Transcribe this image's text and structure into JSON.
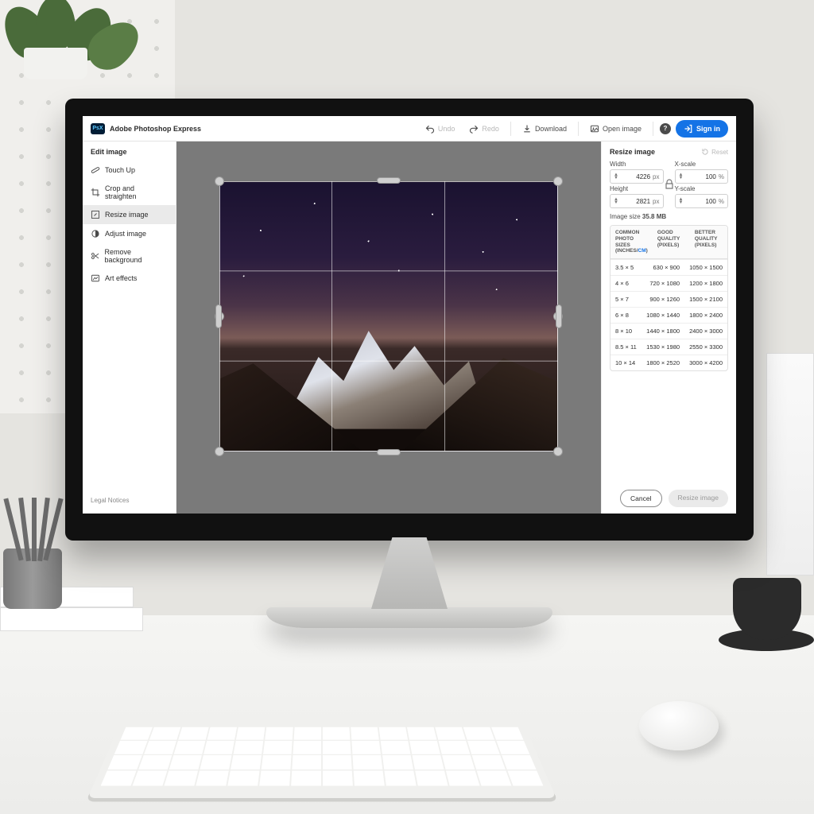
{
  "app": {
    "logo_text": "PsX",
    "title": "Adobe Photoshop Express"
  },
  "topbar": {
    "undo": "Undo",
    "redo": "Redo",
    "download": "Download",
    "open": "Open image",
    "signin": "Sign in",
    "help": "?"
  },
  "sidebar": {
    "title": "Edit image",
    "items": [
      {
        "label": "Touch Up"
      },
      {
        "label": "Crop and straighten"
      },
      {
        "label": "Resize image"
      },
      {
        "label": "Adjust image"
      },
      {
        "label": "Remove background"
      },
      {
        "label": "Art effects"
      }
    ],
    "active_index": 2,
    "legal": "Legal Notices"
  },
  "panel": {
    "title": "Resize image",
    "reset": "Reset",
    "width_label": "Width",
    "width_value": "4226",
    "width_unit": "px",
    "height_label": "Height",
    "height_value": "2821",
    "height_unit": "px",
    "xscale_label": "X-scale",
    "xscale_value": "100",
    "xscale_unit": "%",
    "yscale_label": "Y-scale",
    "yscale_value": "100",
    "yscale_unit": "%",
    "size_label": "Image size",
    "size_value": "35.8 MB",
    "table": {
      "head_sizes_l1": "COMMON",
      "head_sizes_l2": "PHOTO SIZES",
      "head_sizes_unit_in": "INCHES",
      "head_sizes_unit_sep": "/",
      "head_sizes_unit_cm": "CM",
      "head_good_l1": "GOOD",
      "head_good_l2": "QUALITY",
      "head_good_l3": "(PIXELS)",
      "head_better_l1": "BETTER",
      "head_better_l2": "QUALITY",
      "head_better_l3": "(PIXELS)",
      "rows": [
        {
          "size": "3.5 × 5",
          "good": "630 × 900",
          "better": "1050 × 1500"
        },
        {
          "size": "4 × 6",
          "good": "720 × 1080",
          "better": "1200 × 1800"
        },
        {
          "size": "5 × 7",
          "good": "900 × 1260",
          "better": "1500 × 2100"
        },
        {
          "size": "6 × 8",
          "good": "1080 × 1440",
          "better": "1800 × 2400"
        },
        {
          "size": "8 × 10",
          "good": "1440 × 1800",
          "better": "2400 × 3000"
        },
        {
          "size": "8.5 × 11",
          "good": "1530 × 1980",
          "better": "2550 × 3300"
        },
        {
          "size": "10 × 14",
          "good": "1800 × 2520",
          "better": "3000 × 4200"
        }
      ]
    },
    "cancel": "Cancel",
    "apply": "Resize image"
  }
}
